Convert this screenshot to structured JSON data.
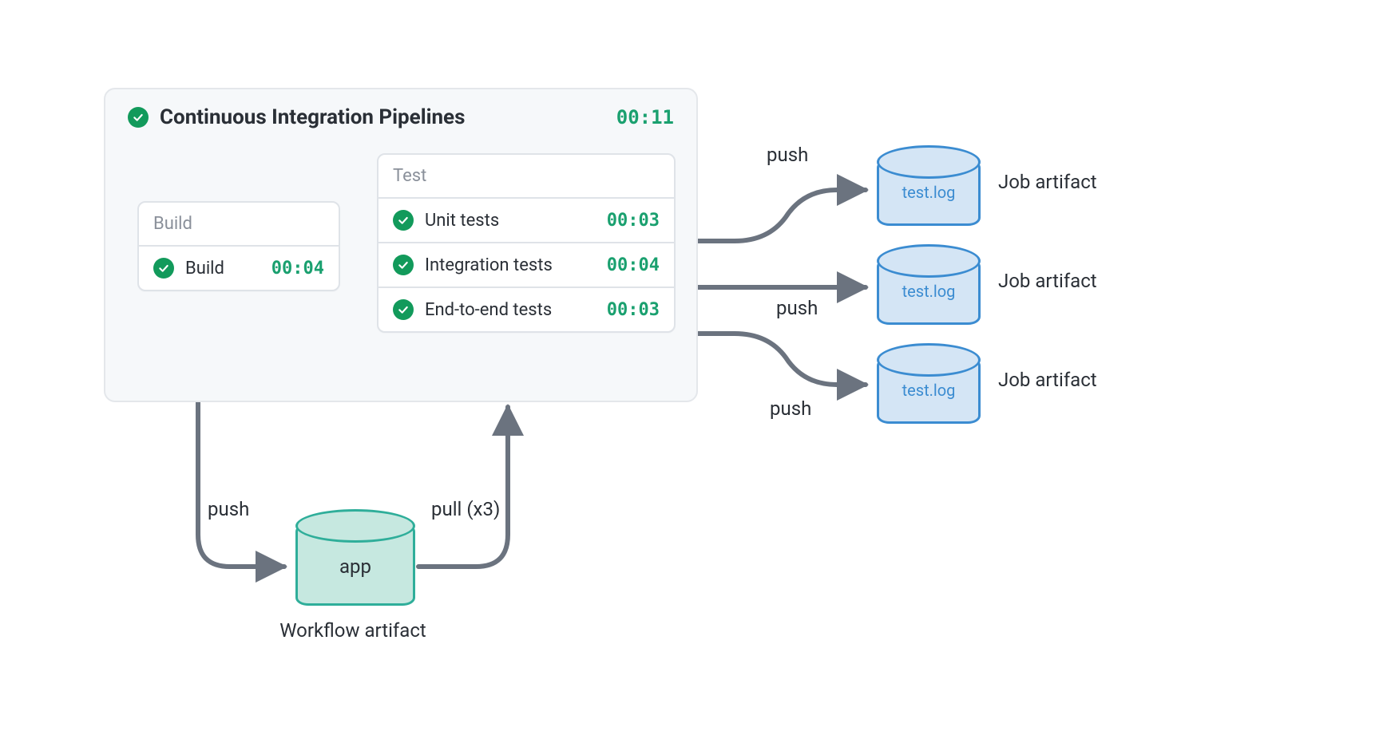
{
  "pipeline": {
    "title": "Continuous Integration Pipelines",
    "total_time": "00:11",
    "stages": {
      "build": {
        "title": "Build",
        "jobs": [
          {
            "name": "Build",
            "time": "00:04",
            "status": "success"
          }
        ]
      },
      "test": {
        "title": "Test",
        "jobs": [
          {
            "name": "Unit tests",
            "time": "00:03",
            "status": "success"
          },
          {
            "name": "Integration tests",
            "time": "00:04",
            "status": "success"
          },
          {
            "name": "End-to-end tests",
            "time": "00:03",
            "status": "success"
          }
        ]
      }
    }
  },
  "workflow_artifact": {
    "name": "app",
    "caption": "Workflow artifact",
    "push_label": "push",
    "pull_label": "pull (x3)"
  },
  "job_artifacts": [
    {
      "file": "test.log",
      "caption": "Job artifact",
      "push_label": "push"
    },
    {
      "file": "test.log",
      "caption": "Job artifact",
      "push_label": "push"
    },
    {
      "file": "test.log",
      "caption": "Job artifact",
      "push_label": "push"
    }
  ]
}
